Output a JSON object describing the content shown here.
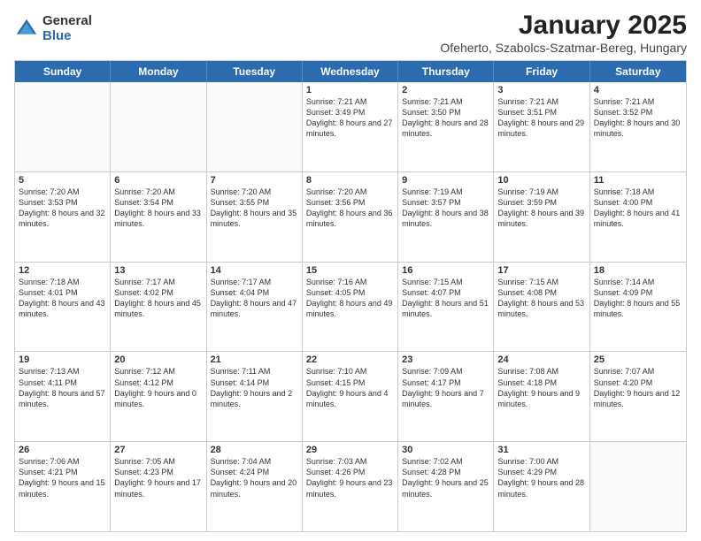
{
  "logo": {
    "general": "General",
    "blue": "Blue"
  },
  "title": "January 2025",
  "location": "Ofeherto, Szabolcs-Szatmar-Bereg, Hungary",
  "header": {
    "days": [
      "Sunday",
      "Monday",
      "Tuesday",
      "Wednesday",
      "Thursday",
      "Friday",
      "Saturday"
    ]
  },
  "weeks": [
    [
      {
        "day": "",
        "info": ""
      },
      {
        "day": "",
        "info": ""
      },
      {
        "day": "",
        "info": ""
      },
      {
        "day": "1",
        "info": "Sunrise: 7:21 AM\nSunset: 3:49 PM\nDaylight: 8 hours and 27 minutes."
      },
      {
        "day": "2",
        "info": "Sunrise: 7:21 AM\nSunset: 3:50 PM\nDaylight: 8 hours and 28 minutes."
      },
      {
        "day": "3",
        "info": "Sunrise: 7:21 AM\nSunset: 3:51 PM\nDaylight: 8 hours and 29 minutes."
      },
      {
        "day": "4",
        "info": "Sunrise: 7:21 AM\nSunset: 3:52 PM\nDaylight: 8 hours and 30 minutes."
      }
    ],
    [
      {
        "day": "5",
        "info": "Sunrise: 7:20 AM\nSunset: 3:53 PM\nDaylight: 8 hours and 32 minutes."
      },
      {
        "day": "6",
        "info": "Sunrise: 7:20 AM\nSunset: 3:54 PM\nDaylight: 8 hours and 33 minutes."
      },
      {
        "day": "7",
        "info": "Sunrise: 7:20 AM\nSunset: 3:55 PM\nDaylight: 8 hours and 35 minutes."
      },
      {
        "day": "8",
        "info": "Sunrise: 7:20 AM\nSunset: 3:56 PM\nDaylight: 8 hours and 36 minutes."
      },
      {
        "day": "9",
        "info": "Sunrise: 7:19 AM\nSunset: 3:57 PM\nDaylight: 8 hours and 38 minutes."
      },
      {
        "day": "10",
        "info": "Sunrise: 7:19 AM\nSunset: 3:59 PM\nDaylight: 8 hours and 39 minutes."
      },
      {
        "day": "11",
        "info": "Sunrise: 7:18 AM\nSunset: 4:00 PM\nDaylight: 8 hours and 41 minutes."
      }
    ],
    [
      {
        "day": "12",
        "info": "Sunrise: 7:18 AM\nSunset: 4:01 PM\nDaylight: 8 hours and 43 minutes."
      },
      {
        "day": "13",
        "info": "Sunrise: 7:17 AM\nSunset: 4:02 PM\nDaylight: 8 hours and 45 minutes."
      },
      {
        "day": "14",
        "info": "Sunrise: 7:17 AM\nSunset: 4:04 PM\nDaylight: 8 hours and 47 minutes."
      },
      {
        "day": "15",
        "info": "Sunrise: 7:16 AM\nSunset: 4:05 PM\nDaylight: 8 hours and 49 minutes."
      },
      {
        "day": "16",
        "info": "Sunrise: 7:15 AM\nSunset: 4:07 PM\nDaylight: 8 hours and 51 minutes."
      },
      {
        "day": "17",
        "info": "Sunrise: 7:15 AM\nSunset: 4:08 PM\nDaylight: 8 hours and 53 minutes."
      },
      {
        "day": "18",
        "info": "Sunrise: 7:14 AM\nSunset: 4:09 PM\nDaylight: 8 hours and 55 minutes."
      }
    ],
    [
      {
        "day": "19",
        "info": "Sunrise: 7:13 AM\nSunset: 4:11 PM\nDaylight: 8 hours and 57 minutes."
      },
      {
        "day": "20",
        "info": "Sunrise: 7:12 AM\nSunset: 4:12 PM\nDaylight: 9 hours and 0 minutes."
      },
      {
        "day": "21",
        "info": "Sunrise: 7:11 AM\nSunset: 4:14 PM\nDaylight: 9 hours and 2 minutes."
      },
      {
        "day": "22",
        "info": "Sunrise: 7:10 AM\nSunset: 4:15 PM\nDaylight: 9 hours and 4 minutes."
      },
      {
        "day": "23",
        "info": "Sunrise: 7:09 AM\nSunset: 4:17 PM\nDaylight: 9 hours and 7 minutes."
      },
      {
        "day": "24",
        "info": "Sunrise: 7:08 AM\nSunset: 4:18 PM\nDaylight: 9 hours and 9 minutes."
      },
      {
        "day": "25",
        "info": "Sunrise: 7:07 AM\nSunset: 4:20 PM\nDaylight: 9 hours and 12 minutes."
      }
    ],
    [
      {
        "day": "26",
        "info": "Sunrise: 7:06 AM\nSunset: 4:21 PM\nDaylight: 9 hours and 15 minutes."
      },
      {
        "day": "27",
        "info": "Sunrise: 7:05 AM\nSunset: 4:23 PM\nDaylight: 9 hours and 17 minutes."
      },
      {
        "day": "28",
        "info": "Sunrise: 7:04 AM\nSunset: 4:24 PM\nDaylight: 9 hours and 20 minutes."
      },
      {
        "day": "29",
        "info": "Sunrise: 7:03 AM\nSunset: 4:26 PM\nDaylight: 9 hours and 23 minutes."
      },
      {
        "day": "30",
        "info": "Sunrise: 7:02 AM\nSunset: 4:28 PM\nDaylight: 9 hours and 25 minutes."
      },
      {
        "day": "31",
        "info": "Sunrise: 7:00 AM\nSunset: 4:29 PM\nDaylight: 9 hours and 28 minutes."
      },
      {
        "day": "",
        "info": ""
      }
    ]
  ]
}
